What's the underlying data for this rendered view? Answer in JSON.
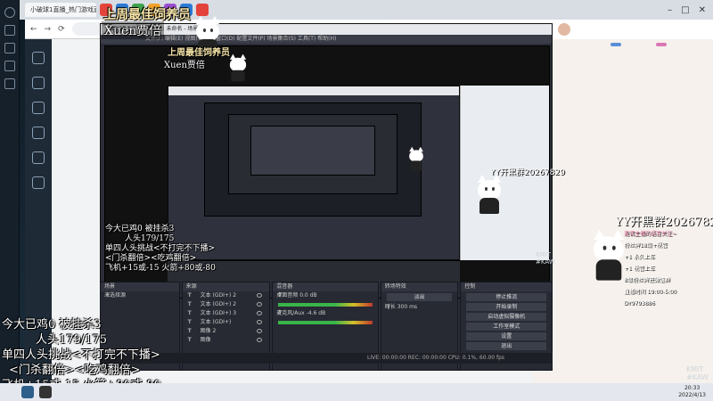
{
  "tabs": [
    {
      "label": "小破球1直播_热门游戏直播..."
    },
    {
      "label": "..."
    },
    {
      "label": "..."
    }
  ],
  "obs": {
    "title": "OBS 27.1.3 - 配置文件: 未命名 - 场景: 未命名",
    "menu": "文件(F)  编辑(E)  视图(V)  停靠窗口(D)  配置文件(P)  场景集合(S)  工具(T)  帮助(H)",
    "scene_dock": "场景",
    "source_dock": "来源",
    "mixer_dock": "混音器",
    "transition_dock": "转场特效",
    "controls_dock": "控制",
    "scene_placeholder": "未选择源",
    "filters_label": "滤镜",
    "sources": [
      "文本 (GDI+) 2",
      "文本 (GDI+) 2",
      "文本 (GDI+) 3",
      "文本 (GDI+)",
      "图像 2",
      "图像"
    ],
    "mixer": [
      {
        "name": "桌面音频",
        "level": "0.0 dB"
      },
      {
        "name": "麦克风/Aux",
        "level": "-4.6 dB"
      }
    ],
    "transition": {
      "type": "淡出",
      "duration_label": "时长",
      "duration": "300 ms"
    },
    "controls": [
      "停止推流",
      "开始录制",
      "启动虚拟摄像机",
      "工作室模式",
      "设置",
      "退出"
    ],
    "status": "LIVE: 00:00:00   REC: 00:00:00   CPU: 0.1%, 60.00 fps"
  },
  "overlay": {
    "banner": "上周最佳饲养员",
    "name": "Xuen贾倍",
    "stats": [
      "今大已鸡0 被挂杀3",
      "人头179/175",
      "单四人头挑战<不打完不下播>",
      "<门杀翻倍><吃鸡翻倍>",
      "飞机+15或-15 火箭+80或-80"
    ]
  },
  "right_overlay": {
    "yy_big": "YY开黑群20267829",
    "yy_small": "YY开黑群20267829",
    "info": [
      "邀请主播的语音关注~",
      "粉丝牌18级+视管",
      "+1 永久上车",
      "+1 视管上车",
      "8级粉丝牌进微信群",
      "直播时间 19:00-5:00",
      "DY9793886"
    ]
  },
  "watermark": [
    "KMIT",
    "#KAW"
  ],
  "clock": {
    "time": "20:33",
    "date": "2022/4/13"
  },
  "colors": {
    "obs_bg": "#2b2e38",
    "meter_green": "#39b54a",
    "accent_pink": "#ff9fc5"
  }
}
